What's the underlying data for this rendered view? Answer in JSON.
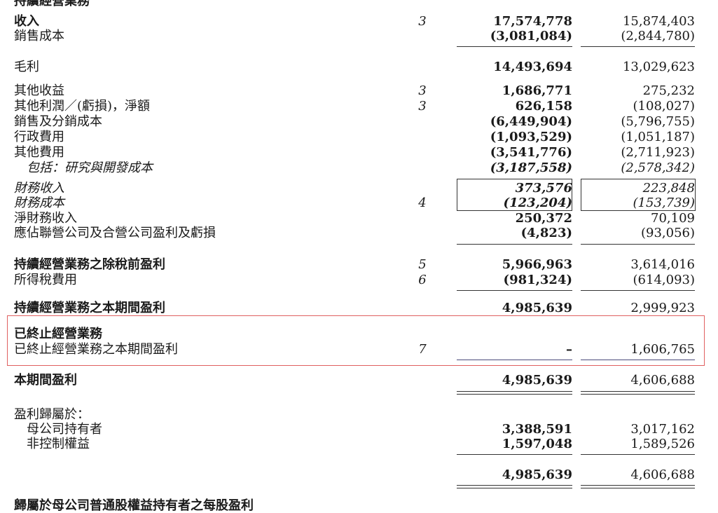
{
  "heading_cut": "持續經營業務",
  "footer_cut": "歸屬於母公司普通股權益持有者之每股盈利",
  "rows": [
    {
      "label": "收入",
      "note": "3",
      "current": "17,574,778",
      "prior": "15,874,403"
    },
    {
      "label": "銷售成本",
      "current": "(3,081,084)",
      "prior": "(2,844,780)"
    },
    {
      "label": "毛利",
      "current": "14,493,694",
      "prior": "13,029,623"
    },
    {
      "label": "其他收益",
      "note": "3",
      "current": "1,686,771",
      "prior": "275,232"
    },
    {
      "label": "其他利潤／(虧損)，淨額",
      "note": "3",
      "current": "626,158",
      "prior": "(108,027)"
    },
    {
      "label": "銷售及分銷成本",
      "current": "(6,449,904)",
      "prior": "(5,796,755)"
    },
    {
      "label": "行政費用",
      "current": "(1,093,529)",
      "prior": "(1,051,187)"
    },
    {
      "label": "其他費用",
      "current": "(3,541,776)",
      "prior": "(2,711,923)"
    },
    {
      "label": "包括：研究與開發成本",
      "current": "(3,187,558)",
      "prior": "(2,578,342)"
    },
    {
      "label": "財務收入",
      "current": "373,576",
      "prior": "223,848"
    },
    {
      "label": "財務成本",
      "note": "4",
      "current": "(123,204)",
      "prior": "(153,739)"
    },
    {
      "label": "淨財務收入",
      "current": "250,372",
      "prior": "70,109"
    },
    {
      "label": "應佔聯營公司及合營公司盈利及虧損",
      "current": "(4,823)",
      "prior": "(93,056)"
    },
    {
      "label": "持續經營業務之除稅前盈利",
      "note": "5",
      "current": "5,966,963",
      "prior": "3,614,016"
    },
    {
      "label": "所得稅費用",
      "note": "6",
      "current": "(981,324)",
      "prior": "(614,093)"
    },
    {
      "label": "持續經營業務之本期間盈利",
      "current": "4,985,639",
      "prior": "2,999,923"
    },
    {
      "label": "已終止經營業務"
    },
    {
      "label": "已終止經營業務之本期間盈利",
      "note": "7",
      "current": "–",
      "prior": "1,606,765"
    },
    {
      "label": "本期間盈利",
      "current": "4,985,639",
      "prior": "4,606,688"
    },
    {
      "label": "盈利歸屬於："
    },
    {
      "label": "母公司持有者",
      "current": "3,388,591",
      "prior": "3,017,162"
    },
    {
      "label": "非控制權益",
      "current": "1,597,048",
      "prior": "1,589,526"
    },
    {
      "label": "",
      "current": "4,985,639",
      "prior": "4,606,688"
    }
  ]
}
